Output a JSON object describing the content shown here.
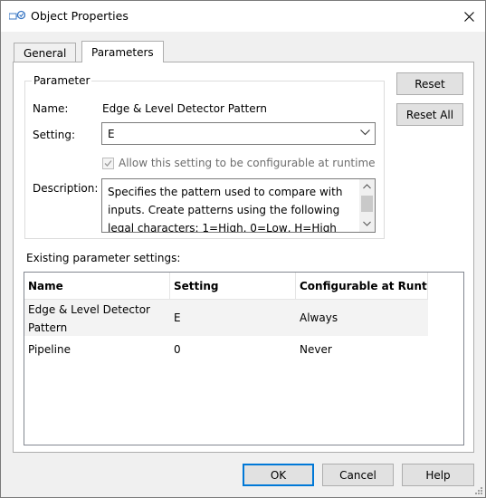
{
  "window": {
    "title": "Object Properties",
    "icon": "object-properties-icon"
  },
  "tabs": [
    {
      "label": "General",
      "active": false
    },
    {
      "label": "Parameters",
      "active": true
    }
  ],
  "parameter": {
    "group_label": "Parameter",
    "name_label": "Name:",
    "name_value": "Edge & Level Detector Pattern",
    "setting_label": "Setting:",
    "setting_value": "E",
    "runtime_checkbox": {
      "label": "Allow this setting to be configurable at runtime",
      "checked": true,
      "enabled": false
    },
    "description_label": "Description:",
    "description_lines": [
      "Specifies the pattern used to compare with",
      "inputs. Create patterns using the following",
      "legal characters: 1=High, 0=Low, H=High"
    ]
  },
  "side_buttons": {
    "reset": "Reset",
    "reset_all": "Reset All"
  },
  "existing": {
    "label": "Existing parameter settings:",
    "columns": [
      "Name",
      "Setting",
      "Configurable at Runtime"
    ],
    "rows": [
      {
        "name": "Edge & Level Detector Pattern",
        "setting": "E",
        "configurable": "Always"
      },
      {
        "name": "Pipeline",
        "setting": "0",
        "configurable": "Never"
      }
    ]
  },
  "footer": {
    "ok": "OK",
    "cancel": "Cancel",
    "help": "Help"
  }
}
